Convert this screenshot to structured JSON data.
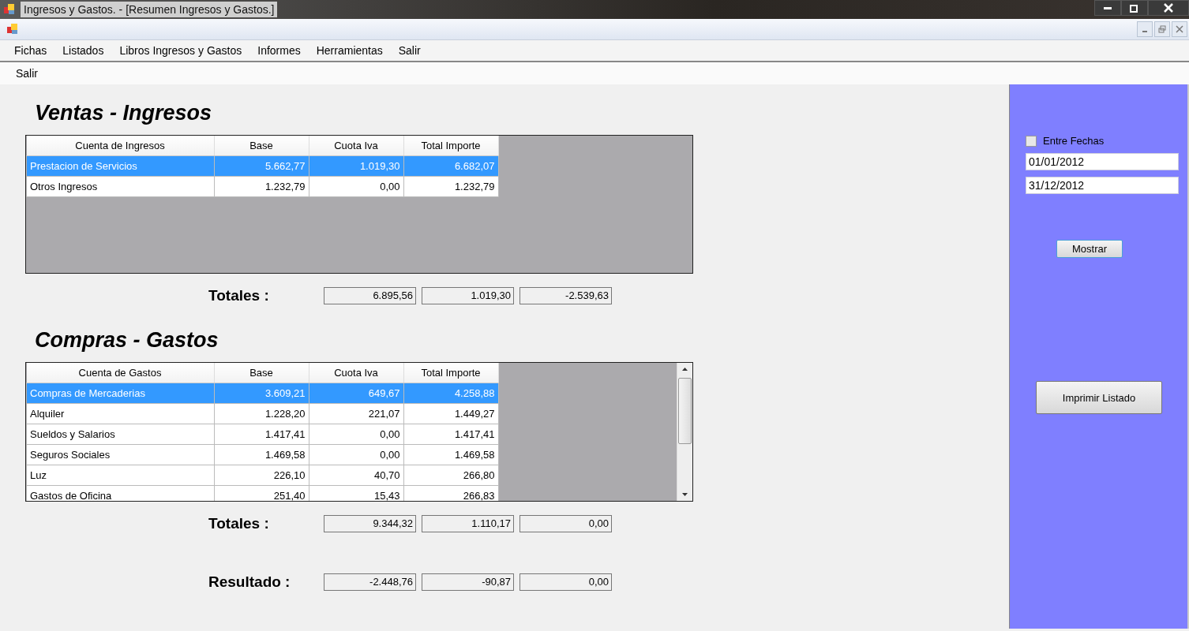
{
  "window": {
    "title": "Ingresos y Gastos. - [Resumen Ingresos y Gastos.]"
  },
  "menu": [
    {
      "label": "Fichas"
    },
    {
      "label": "Listados"
    },
    {
      "label": "Libros Ingresos y Gastos"
    },
    {
      "label": "Informes"
    },
    {
      "label": "Herramientas"
    },
    {
      "label": "Salir"
    }
  ],
  "toolbar": [
    {
      "label": "Salir"
    }
  ],
  "sections": [
    {
      "title": "Ventas - Ingresos",
      "scrollbar": false,
      "columns": [
        "Cuenta de Ingresos",
        "Base",
        "Cuota Iva",
        "Total Importe"
      ],
      "rows": [
        {
          "cells": [
            "Prestacion de Servicios",
            "5.662,77",
            "1.019,30",
            "6.682,07"
          ],
          "selected": true
        },
        {
          "cells": [
            "Otros Ingresos",
            "1.232,79",
            "0,00",
            "1.232,79"
          ],
          "selected": false
        }
      ],
      "totals": {
        "label": "Totales :",
        "values": [
          "6.895,56",
          "1.019,30",
          "-2.539,63"
        ]
      }
    },
    {
      "title": "Compras - Gastos",
      "scrollbar": true,
      "columns": [
        "Cuenta de Gastos",
        "Base",
        "Cuota Iva",
        "Total Importe"
      ],
      "rows": [
        {
          "cells": [
            "Compras de Mercaderias",
            "3.609,21",
            "649,67",
            "4.258,88"
          ],
          "selected": true
        },
        {
          "cells": [
            "Alquiler",
            "1.228,20",
            "221,07",
            "1.449,27"
          ],
          "selected": false
        },
        {
          "cells": [
            "Sueldos y Salarios",
            "1.417,41",
            "0,00",
            "1.417,41"
          ],
          "selected": false
        },
        {
          "cells": [
            "Seguros Sociales",
            "1.469,58",
            "0,00",
            "1.469,58"
          ],
          "selected": false
        },
        {
          "cells": [
            "Luz",
            "226,10",
            "40,70",
            "266,80"
          ],
          "selected": false
        },
        {
          "cells": [
            "Gastos de Oficina",
            "251,40",
            "15,43",
            "266,83"
          ],
          "selected": false
        }
      ],
      "totals": {
        "label": "Totales :",
        "values": [
          "9.344,32",
          "1.110,17",
          "0,00"
        ]
      }
    }
  ],
  "result": {
    "label": "Resultado :",
    "values": [
      "-2.448,76",
      "-90,87",
      "0,00"
    ]
  },
  "side_panel": {
    "date_range": {
      "label": "Entre Fechas",
      "checked": false
    },
    "date_from": "01/01/2012",
    "date_to": "31/12/2012",
    "show_button": "Mostrar",
    "print_button": "Imprimir Listado"
  }
}
